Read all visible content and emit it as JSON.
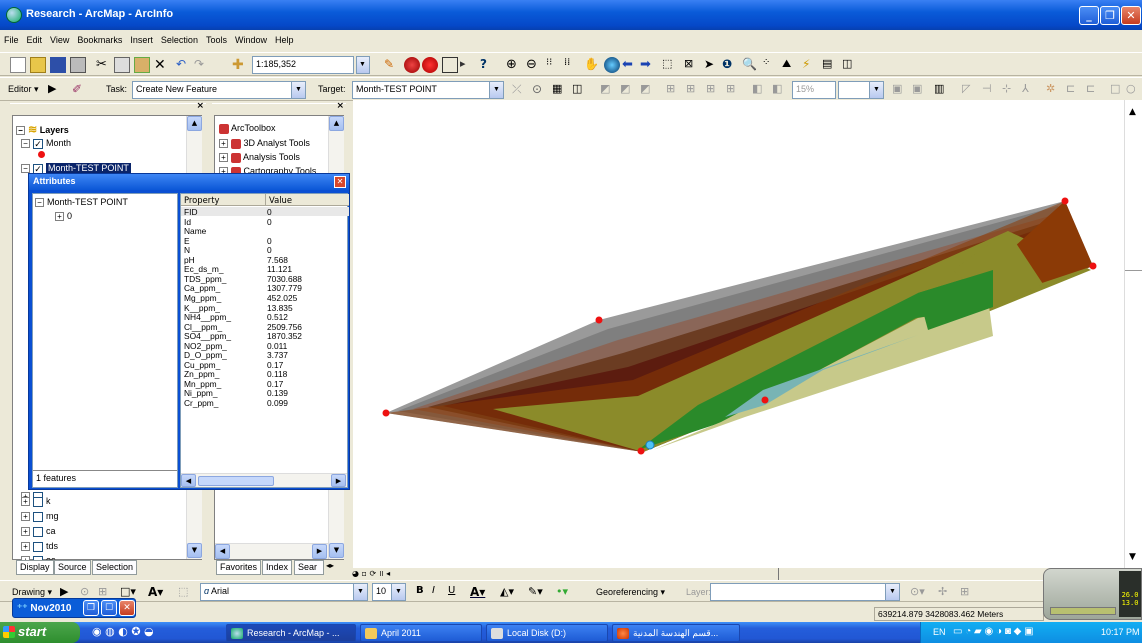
{
  "window": {
    "title": "Research - ArcMap - ArcInfo"
  },
  "menu": [
    "File",
    "Edit",
    "View",
    "Bookmarks",
    "Insert",
    "Selection",
    "Tools",
    "Window",
    "Help"
  ],
  "standard_toolbar": {
    "scale": "1:185,352"
  },
  "editor_toolbar": {
    "editor_label": "Editor",
    "task_label": "Task:",
    "task_value": "Create New Feature",
    "target_label": "Target:",
    "target_value": "Month-TEST POINT",
    "zoom": "15%"
  },
  "toc": {
    "root": "Layers",
    "layers_top": [
      "Month",
      "Month-TEST POINT"
    ],
    "layers_bottom": [
      "k",
      "mg",
      "ca",
      "tds",
      "ec"
    ],
    "tabs": [
      "Display",
      "Source",
      "Selection"
    ]
  },
  "toolbox": {
    "root": "ArcToolbox",
    "items": [
      "3D Analyst Tools",
      "Analysis Tools",
      "Cartography Tools"
    ],
    "tabs": [
      "Favorites",
      "Index",
      "Sear"
    ]
  },
  "attributes": {
    "title": "Attributes",
    "layer": "Month-TEST POINT",
    "feature": "0",
    "count_text": "1 features",
    "col_property": "Property",
    "col_value": "Value",
    "rows": [
      [
        "FID",
        "0"
      ],
      [
        "Id",
        "0"
      ],
      [
        "Name",
        ""
      ],
      [
        "E",
        "0"
      ],
      [
        "N",
        "0"
      ],
      [
        "pH",
        "7.568"
      ],
      [
        "Ec_ds_m_",
        "11.121"
      ],
      [
        "TDS_ppm_",
        "7030.688"
      ],
      [
        "Ca_ppm_",
        "1307.779"
      ],
      [
        "Mg_ppm_",
        "452.025"
      ],
      [
        "K__ppm_",
        "13.835"
      ],
      [
        "NH4__ppm_",
        "0.512"
      ],
      [
        "Cl__ppm_",
        "2509.756"
      ],
      [
        "SO4__ppm_",
        "1870.352"
      ],
      [
        "NO2_ppm_",
        "0.011"
      ],
      [
        "D_O_ppm_",
        "3.737"
      ],
      [
        "Cu_ppm_",
        "0.17"
      ],
      [
        "Zn_ppm_",
        "0.118"
      ],
      [
        "Mn_ppm_",
        "0.17"
      ],
      [
        "Ni_ppm_",
        "0.139"
      ],
      [
        "Cr_ppm_",
        "0.099"
      ]
    ]
  },
  "drawing_toolbar": {
    "drawing_label": "Drawing",
    "font": "Arial",
    "size": "10",
    "georef_label": "Georeferencing",
    "layer_label": "Layer:"
  },
  "status": {
    "coords": "639214.879 3428083.462 Meters"
  },
  "floating_bar": {
    "label": "Nov2010"
  },
  "gauge": {
    "line1": "26.0",
    "line2": "13.0"
  },
  "taskbar": {
    "start": "start",
    "tasks": [
      "Research - ArcMap - ...",
      "April 2011",
      "Local Disk (D:)",
      "قسم الهندسة المدنية..."
    ],
    "lang": "EN",
    "clock": "10:17 PM"
  },
  "colors": {
    "xp_blue": "#0a5bd9",
    "band_outer": "#8b3a06",
    "band_olive": "#8b8b2a",
    "band_green": "#2a8a2a",
    "band_lightgreen": "#c7c98a",
    "band_cyan": "#78b4b4",
    "point_red": "#ee1111"
  }
}
